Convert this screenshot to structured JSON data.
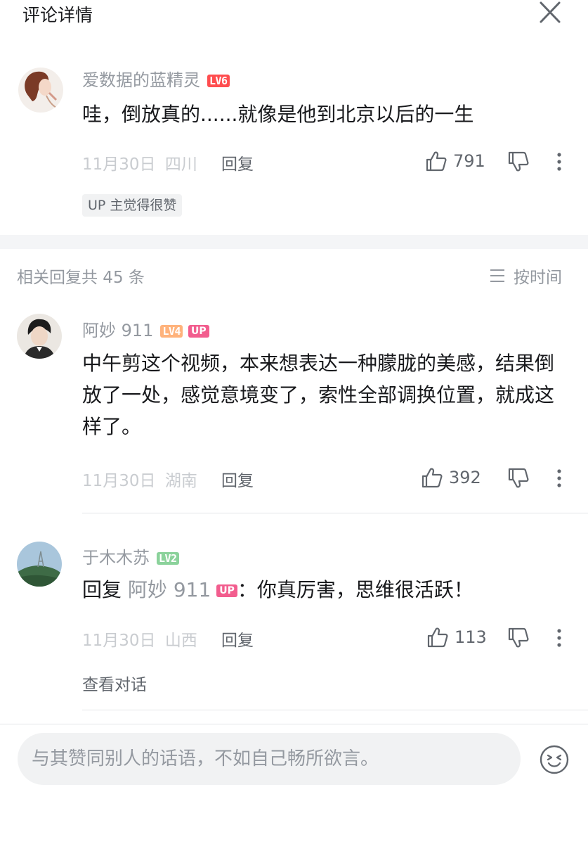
{
  "header": {
    "title": "评论详情"
  },
  "main_comment": {
    "username": "爱数据的蓝精灵",
    "level": "LV6",
    "content": "哇，倒放真的......就像是他到北京以后的一生",
    "date": "11月30日",
    "location": "四川",
    "reply_label": "回复",
    "likes": "791",
    "up_liked_label": "UP 主觉得很赞"
  },
  "replies_header": {
    "count_label": "相关回复共 45 条",
    "sort_label": "按时间"
  },
  "replies": [
    {
      "username": "阿妙 911",
      "level": "LV4",
      "badge": "UP",
      "content": "中午剪这个视频，本来想表达一种朦胧的美感，结果倒放了一处，感觉意境变了，索性全部调换位置，就成这样了。",
      "date": "11月30日",
      "location": "湖南",
      "reply_label": "回复",
      "likes": "392"
    },
    {
      "username": "于木木苏",
      "level": "LV2",
      "content_prefix": "回复",
      "reply_to_user": "阿妙 911",
      "reply_to_badge": "UP",
      "content": "：你真厉害，思维很活跃！",
      "date": "11月30日",
      "location": "山西",
      "reply_label": "回复",
      "likes": "113",
      "view_conversation_label": "查看对话"
    }
  ],
  "composer": {
    "placeholder": "与其赞同别人的话语，不如自己畅所欲言。"
  },
  "colors": {
    "level6": "#ff4d4f",
    "level4": "#ffb37c",
    "level2": "#8bd29b",
    "up_badge": "#f25d8e"
  },
  "icons": [
    "close-icon",
    "like-icon",
    "dislike-icon",
    "more-icon",
    "sort-icon",
    "emoji-icon"
  ]
}
